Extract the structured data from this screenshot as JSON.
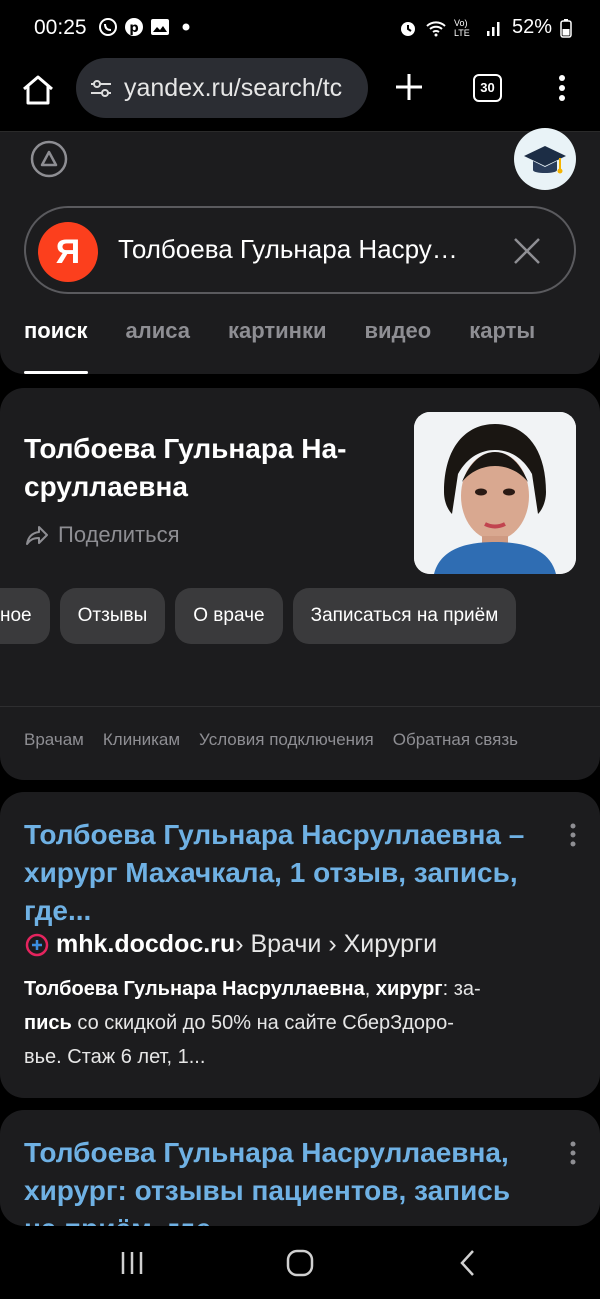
{
  "status": {
    "time": "00:25",
    "battery": "52%",
    "network": "Vo) LTE"
  },
  "browser": {
    "url": "yandex.ru/search/tc",
    "tab_count": "30"
  },
  "search": {
    "query": "Толбоева Гульнара Насру…",
    "logo_letter": "Я",
    "tabs": [
      "поиск",
      "алиса",
      "картинки",
      "видео",
      "карты"
    ]
  },
  "entity": {
    "title_line1": "Толбоева Гульнара На-",
    "title_line2": "сруллаевна",
    "share_label": "Поделиться",
    "chips": [
      "ное",
      "Отзывы",
      "О враче",
      "Записаться на приём"
    ],
    "footer_links": [
      "Врачам",
      "Клиникам",
      "Условия подключения",
      "Обратная связь"
    ]
  },
  "results": [
    {
      "title_line1": "Толбоева Гульнара Насруллаевна –",
      "title_line2": "хирург Махачкала, 1 отзыв, запись,",
      "title_line3": "где...",
      "domain": "mhk.docdoc.ru",
      "path": " › Врачи › Хирурги",
      "snippet_bold1": "Толбоева Гульнара Насруллаевна",
      "snippet_text1": ", ",
      "snippet_bold2": "хирург",
      "snippet_text2": ": за-",
      "snippet_bold3": "пись",
      "snippet_text3": " со скидкой до 50% на сайте СберЗдоро-",
      "snippet_text4": "вье. Стаж 6 лет, 1..."
    },
    {
      "title_line1": "Толбоева Гульнара Насруллаевна,",
      "title_line2": "хирург: отзывы пациентов, запись",
      "title_line3": "на приём, где..."
    }
  ],
  "colors": {
    "accent_link": "#6fb1e4",
    "yandex_red": "#fc3f1d",
    "card_bg": "#1c1c1e"
  }
}
